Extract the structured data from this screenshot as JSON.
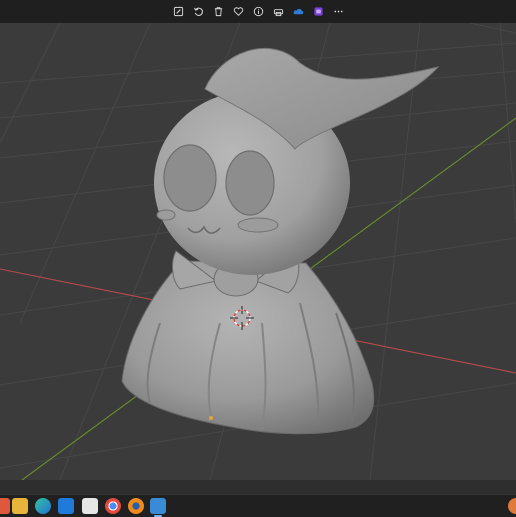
{
  "toolbar": {
    "icons": [
      "edit-icon",
      "rotate-icon",
      "delete-icon",
      "favorite-icon",
      "info-icon",
      "print-icon",
      "onedrive-icon",
      "clipchamp-icon",
      "more-icon"
    ]
  },
  "viewport": {
    "background": "#3b3b3b",
    "grid_color": "#474747",
    "x_axis_color": "#b94b4b",
    "y_axis_color": "#6a8c2e",
    "model_color": "#9a9a9a",
    "model": "mimikyu-sculpt"
  },
  "taskbar": {
    "apps": [
      "start-icon",
      "file-explorer-icon",
      "edge-icon",
      "mail-icon",
      "store-icon",
      "chrome-icon",
      "blender-icon",
      "photos-icon"
    ],
    "active_app": "photos-icon"
  }
}
